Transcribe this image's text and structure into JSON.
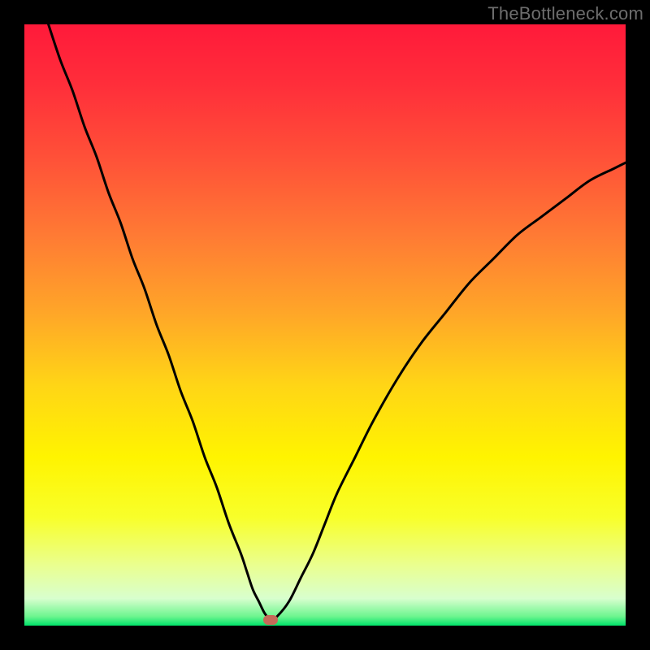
{
  "watermark": "TheBottleneck.com",
  "chart_data": {
    "type": "line",
    "title": "",
    "xlabel": "",
    "ylabel": "",
    "xlim": [
      0,
      100
    ],
    "ylim": [
      0,
      100
    ],
    "grid": false,
    "legend": false,
    "background_gradient": [
      {
        "stop": 0.0,
        "color": "#ff1a3a"
      },
      {
        "stop": 0.1,
        "color": "#ff2e3a"
      },
      {
        "stop": 0.22,
        "color": "#ff5038"
      },
      {
        "stop": 0.35,
        "color": "#ff7a34"
      },
      {
        "stop": 0.48,
        "color": "#ffa628"
      },
      {
        "stop": 0.6,
        "color": "#ffd516"
      },
      {
        "stop": 0.72,
        "color": "#fff400"
      },
      {
        "stop": 0.82,
        "color": "#f8ff2a"
      },
      {
        "stop": 0.9,
        "color": "#eaff90"
      },
      {
        "stop": 0.955,
        "color": "#d8ffce"
      },
      {
        "stop": 0.985,
        "color": "#6cf58e"
      },
      {
        "stop": 1.0,
        "color": "#00e36a"
      }
    ],
    "series": [
      {
        "name": "bottleneck-curve",
        "color": "#000000",
        "x": [
          4,
          6,
          8,
          10,
          12,
          14,
          16,
          18,
          20,
          22,
          24,
          26,
          28,
          30,
          32,
          34,
          36,
          37,
          38,
          39,
          40,
          41,
          42,
          44,
          46,
          48,
          50,
          52,
          55,
          58,
          62,
          66,
          70,
          74,
          78,
          82,
          86,
          90,
          94,
          98,
          100
        ],
        "values": [
          100,
          94,
          89,
          83,
          78,
          72,
          67,
          61,
          56,
          50,
          45,
          39,
          34,
          28,
          23,
          17,
          12,
          9,
          6,
          4,
          2,
          1,
          1.5,
          4,
          8,
          12,
          17,
          22,
          28,
          34,
          41,
          47,
          52,
          57,
          61,
          65,
          68,
          71,
          74,
          76,
          77
        ]
      }
    ],
    "marker": {
      "name": "optimal-point",
      "x": 41,
      "y": 1,
      "color": "#c56a59"
    }
  }
}
